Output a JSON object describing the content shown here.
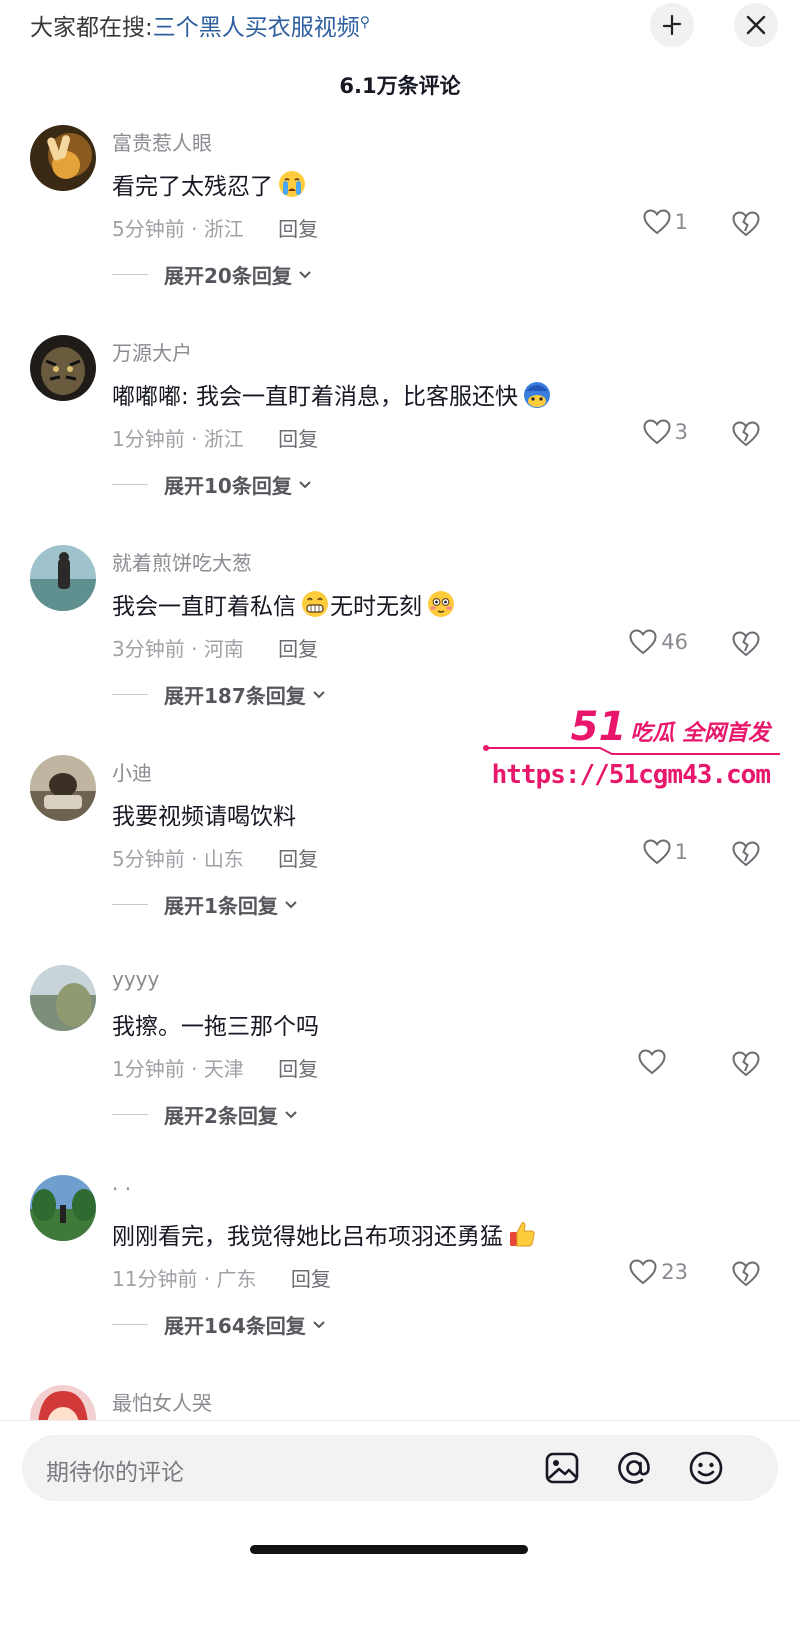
{
  "search": {
    "prefix": "大家都在搜:",
    "query": "三个黑人买衣服视频",
    "search_icon": "magnifier-icon"
  },
  "header": {
    "comment_count": "6.1万条评论",
    "collapse_icon": "collapse-icon",
    "close_icon": "close-icon"
  },
  "comments": [
    {
      "username": "富贵惹人眼",
      "text": "看完了太残忍了",
      "emoji": "crying-emoji",
      "time": "5分钟前",
      "location": "浙江",
      "reply": "回复",
      "likes": "1",
      "expand": "展开20条回复"
    },
    {
      "username": "万源大户",
      "text": "嘟嘟嘟: 我会一直盯着消息，比客服还快",
      "emoji": "cold-face-emoji",
      "time": "1分钟前",
      "location": "浙江",
      "reply": "回复",
      "likes": "3",
      "expand": "展开10条回复"
    },
    {
      "username": "就着煎饼吃大葱",
      "text": "我会一直盯着私信",
      "emoji": "grin-emoji",
      "text2": "无时无刻",
      "emoji2": "flushed-emoji",
      "time": "3分钟前",
      "location": "河南",
      "reply": "回复",
      "likes": "46",
      "expand": "展开187条回复"
    },
    {
      "username": "小迪",
      "text": "我要视频请喝饮料",
      "time": "5分钟前",
      "location": "山东",
      "reply": "回复",
      "likes": "1",
      "expand": "展开1条回复"
    },
    {
      "username": "yyyy",
      "text": "我擦。一拖三那个吗",
      "time": "1分钟前",
      "location": "天津",
      "reply": "回复",
      "likes": "",
      "expand": "展开2条回复"
    },
    {
      "username": "·  ·",
      "text": "刚刚看完，我觉得她比吕布项羽还勇猛",
      "emoji": "thumbs-up-emoji",
      "time": "11分钟前",
      "location": "广东",
      "reply": "回复",
      "likes": "23",
      "expand": "展开164条回复"
    },
    {
      "username": "最怕女人哭"
    }
  ],
  "watermark": {
    "brand_num": "51",
    "brand_text": "吃瓜 全网首发",
    "url": "https://51cgm43.com"
  },
  "input": {
    "placeholder": "期待你的评论",
    "icons": [
      "image-icon",
      "at-icon",
      "emoji-icon"
    ]
  },
  "colors": {
    "link": "#2f5f9e",
    "watermark": "#e8176b",
    "muted": "#8a8b91"
  }
}
